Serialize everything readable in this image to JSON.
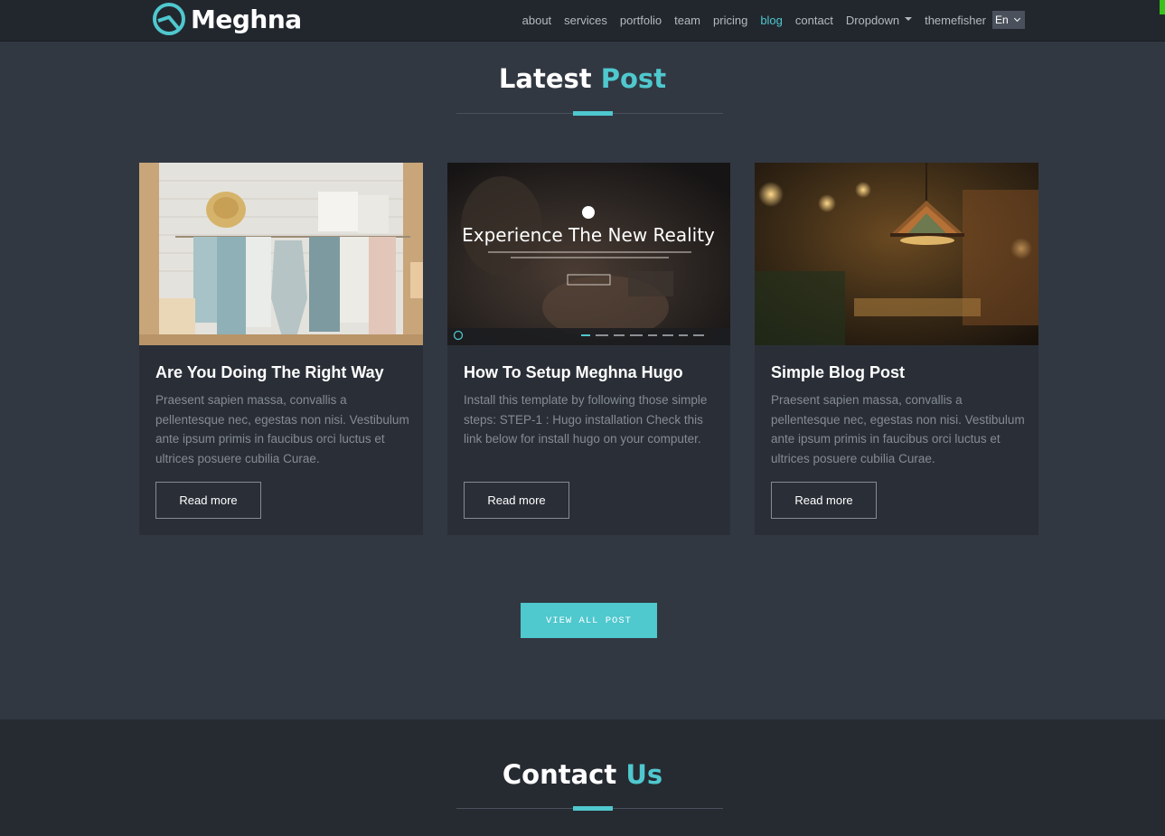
{
  "brand": {
    "name": "Meghna",
    "icon": "logo-icon"
  },
  "nav": {
    "items": [
      {
        "label": "about",
        "active": false
      },
      {
        "label": "services",
        "active": false
      },
      {
        "label": "portfolio",
        "active": false
      },
      {
        "label": "team",
        "active": false
      },
      {
        "label": "pricing",
        "active": false
      },
      {
        "label": "blog",
        "active": true
      },
      {
        "label": "contact",
        "active": false
      }
    ],
    "dropdown_label": "Dropdown",
    "themefisher_label": "themefisher",
    "language": "En"
  },
  "latest": {
    "title_main": "Latest",
    "title_accent": "Post",
    "posts": [
      {
        "title": "Are You Doing The Right Way",
        "excerpt": "Praesent sapien massa, convallis a pellentesque nec, egestas non nisi. Vestibulum ante ipsum primis in faucibus orci luctus et ultrices posuere cubilia Curae.",
        "button": "Read more",
        "image": "clothes-rack-photo"
      },
      {
        "title": "How To Setup Meghna Hugo",
        "excerpt": "Install this template by following those simple steps: STEP-1 : Hugo installation Check this link below for install hugo on your computer.",
        "button": "Read more",
        "image": "theme-preview-screenshot",
        "image_caption": "Experience The New Reality"
      },
      {
        "title": "Simple Blog Post",
        "excerpt": "Praesent sapien massa, convallis a pellentesque nec, egestas non nisi. Vestibulum ante ipsum primis in faucibus orci luctus et ultrices posuere cubilia Curae.",
        "button": "Read more",
        "image": "cafe-lamp-photo"
      }
    ],
    "view_all": "VIEW ALL POST"
  },
  "contact": {
    "title_main": "Contact",
    "title_accent": "Us"
  },
  "colors": {
    "accent": "#4fc8ce",
    "background": "#323842",
    "navbar": "#22272e",
    "card": "#2a2f37"
  }
}
